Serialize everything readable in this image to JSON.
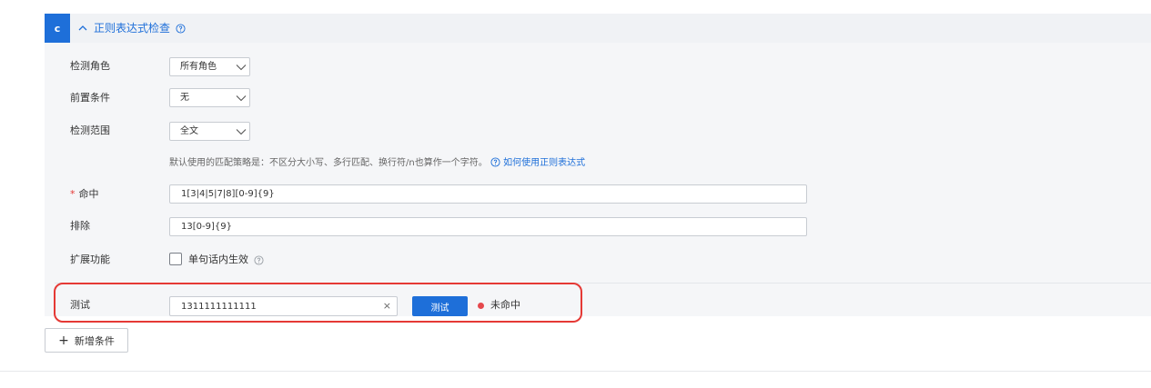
{
  "section": {
    "badge": "c",
    "title": "正则表达式检查",
    "colors": {
      "accent": "#1e6fd9",
      "error": "#e53935"
    }
  },
  "fields": {
    "detect_role": {
      "label": "检测角色",
      "value": "所有角色"
    },
    "precondition": {
      "label": "前置条件",
      "value": "无"
    },
    "detect_scope": {
      "label": "检测范围",
      "value": "全文"
    },
    "hint": {
      "text": "默认使用的匹配策略是：不区分大小写、多行匹配、换行符/n也算作一个字符。",
      "link": "如何使用正则表达式"
    },
    "hit": {
      "required_mark": "*",
      "label": "命中",
      "value": "1[3|4|5|7|8][0-9]{9}"
    },
    "exclude": {
      "label": "排除",
      "value": "13[0-9]{9}"
    },
    "extension": {
      "label": "扩展功能",
      "checkbox_label": "单句话内生效",
      "checked": false
    }
  },
  "test": {
    "label": "测试",
    "input_value": "1311111111111",
    "clear_icon": "×",
    "button_label": "测试",
    "status": "未命中",
    "status_color": "#e5484d"
  },
  "footer": {
    "add_condition_plus": "+",
    "add_condition_label": "新增条件"
  }
}
